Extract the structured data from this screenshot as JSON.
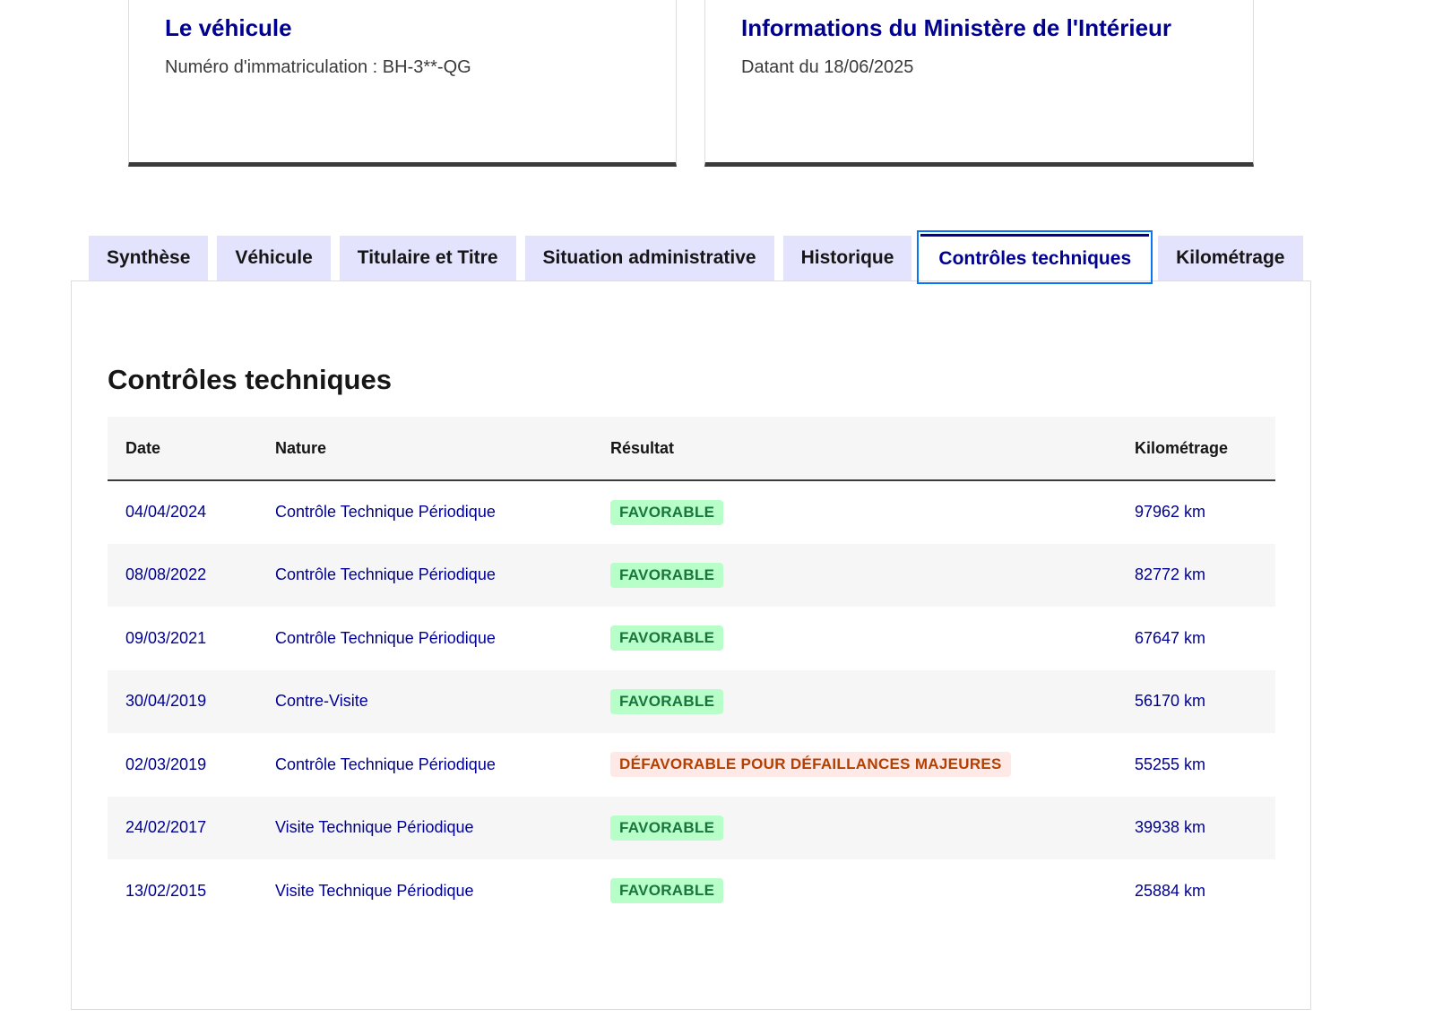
{
  "cards": [
    {
      "title": "Le véhicule",
      "description": "Numéro d'immatriculation : BH-3**-QG"
    },
    {
      "title": "Informations du Ministère de l'Intérieur",
      "description": "Datant du 18/06/2025"
    }
  ],
  "tabs": [
    {
      "label": "Synthèse",
      "active": false
    },
    {
      "label": "Véhicule",
      "active": false
    },
    {
      "label": "Titulaire et Titre",
      "active": false
    },
    {
      "label": "Situation administrative",
      "active": false
    },
    {
      "label": "Historique",
      "active": false
    },
    {
      "label": "Contrôles techniques",
      "active": true
    },
    {
      "label": "Kilométrage",
      "active": false
    }
  ],
  "section": {
    "title": "Contrôles techniques"
  },
  "table": {
    "headers": {
      "date": "Date",
      "nature": "Nature",
      "result": "Résultat",
      "mileage": "Kilométrage"
    },
    "rows": [
      {
        "date": "04/04/2024",
        "nature": "Contrôle Technique Périodique",
        "result": "FAVORABLE",
        "status": "success",
        "mileage": "97962 km"
      },
      {
        "date": "08/08/2022",
        "nature": "Contrôle Technique Périodique",
        "result": "FAVORABLE",
        "status": "success",
        "mileage": "82772 km"
      },
      {
        "date": "09/03/2021",
        "nature": "Contrôle Technique Périodique",
        "result": "FAVORABLE",
        "status": "success",
        "mileage": "67647 km"
      },
      {
        "date": "30/04/2019",
        "nature": "Contre-Visite",
        "result": "FAVORABLE",
        "status": "success",
        "mileage": "56170 km"
      },
      {
        "date": "02/03/2019",
        "nature": "Contrôle Technique Périodique",
        "result": "DÉFAVORABLE POUR DÉFAILLANCES MAJEURES",
        "status": "error",
        "mileage": "55255 km"
      },
      {
        "date": "24/02/2017",
        "nature": "Visite Technique Périodique",
        "result": "FAVORABLE",
        "status": "success",
        "mileage": "39938 km"
      },
      {
        "date": "13/02/2015",
        "nature": "Visite Technique Périodique",
        "result": "FAVORABLE",
        "status": "success",
        "mileage": "25884 km"
      }
    ]
  },
  "colors": {
    "primary_blue": "#000091",
    "tab_background": "#e3e3fd",
    "success_bg": "#b8fec9",
    "success_text": "#18753c",
    "error_bg": "#ffe9e6",
    "error_text": "#b34000",
    "focus_outline": "#0a76f6"
  }
}
